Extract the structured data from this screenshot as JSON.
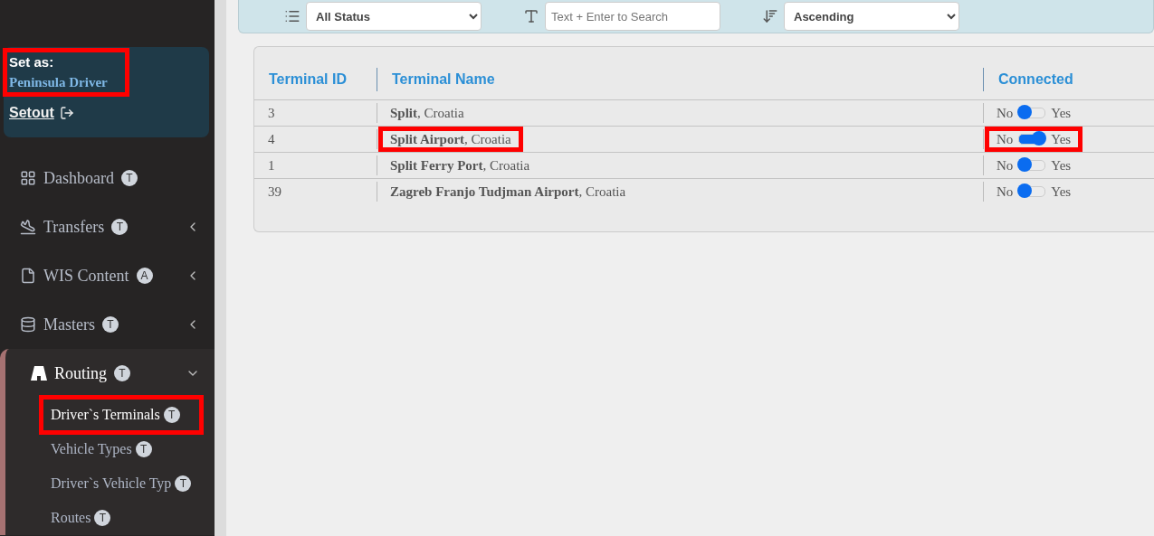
{
  "sidebar": {
    "profile": {
      "label": "Set as:",
      "name": "Peninsula Driver",
      "highlighted": true,
      "setout": "Setout"
    },
    "items": [
      {
        "kind": "link",
        "label": "Dashboard",
        "badge": "T"
      },
      {
        "kind": "group",
        "label": "Transfers",
        "badge": "T",
        "expanded": false
      },
      {
        "kind": "group",
        "label": "WIS Content",
        "badge": "A",
        "expanded": false
      },
      {
        "kind": "group",
        "label": "Masters",
        "badge": "T",
        "expanded": false
      },
      {
        "kind": "group",
        "label": "Routing",
        "badge": "T",
        "expanded": true,
        "children": [
          {
            "label": "Driver`s Terminals",
            "badge": "T",
            "selected": true,
            "highlighted": true
          },
          {
            "label": "Vehicle Types",
            "badge": "T",
            "selected": false,
            "highlighted": false
          },
          {
            "label": "Driver`s Vehicle Typ",
            "badge": "T",
            "selected": false,
            "highlighted": false
          },
          {
            "label": "Routes",
            "badge": "T",
            "selected": false,
            "highlighted": false
          }
        ]
      }
    ]
  },
  "filters": {
    "status": "All Status",
    "search_placeholder": "Text + Enter to Search",
    "sort": "Ascending"
  },
  "table": {
    "columns": [
      "Terminal ID",
      "Terminal Name",
      "Connected"
    ],
    "rows": [
      {
        "id": "3",
        "name": "Split",
        "country": ", Croatia",
        "off_label": "No",
        "on_label": "Yes",
        "on": false,
        "highlighted": false
      },
      {
        "id": "4",
        "name": "Split Airport",
        "country": ", Croatia",
        "off_label": "No",
        "on_label": "Yes",
        "on": true,
        "highlighted": true
      },
      {
        "id": "1",
        "name": "Split Ferry Port",
        "country": ", Croatia",
        "off_label": "No",
        "on_label": "Yes",
        "on": false,
        "highlighted": false
      },
      {
        "id": "39",
        "name": "Zagreb Franjo Tudjman Airport",
        "country": ", Croatia",
        "off_label": "No",
        "on_label": "Yes",
        "on": false,
        "highlighted": false
      }
    ]
  }
}
